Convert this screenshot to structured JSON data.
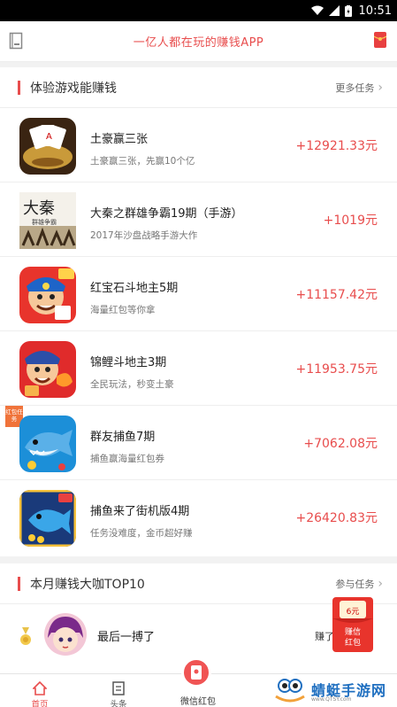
{
  "status_bar": {
    "time": "10:51"
  },
  "header": {
    "title": "一亿人都在玩的赚钱APP"
  },
  "experience_section": {
    "title": "体验游戏能赚钱",
    "more_label": "更多任务",
    "games": [
      {
        "name": "土豪赢三张",
        "desc": "土豪赢三张，先赢10个亿",
        "reward": "+12921.33元",
        "icon": "poker-cards-icon"
      },
      {
        "name": "大秦之群雄争霸19期（手游）",
        "desc": "2017年沙盘战略手游大作",
        "reward": "+1019元",
        "icon": "daqin-game-icon"
      },
      {
        "name": "红宝石斗地主5期",
        "desc": "海量红包等你拿",
        "reward": "+11157.42元",
        "icon": "landlord-game-icon"
      },
      {
        "name": "锦鲤斗地主3期",
        "desc": "全民玩法，秒变土豪",
        "reward": "+11953.75元",
        "icon": "koi-landlord-game-icon"
      },
      {
        "name": "群友捕鱼7期",
        "desc": "捕鱼赢海量红包券",
        "reward": "+7062.08元",
        "icon": "shark-fishing-game-icon",
        "badge": "红包任务"
      },
      {
        "name": "捕鱼来了街机版4期",
        "desc": "任务没难度，金币超好赚",
        "reward": "+26420.83元",
        "icon": "arcade-fishing-game-icon"
      }
    ]
  },
  "top_section": {
    "title": "本月赚钱大咖TOP10",
    "more_label": "参与任务",
    "entries": [
      {
        "name": "最后一搏了",
        "amount": "赚了"
      }
    ]
  },
  "float_badge": {
    "amount": "6元",
    "line1": "赚信",
    "line2": "红包"
  },
  "tab_bar": {
    "tabs": [
      "首页",
      "头条",
      "微信红包"
    ]
  },
  "watermark": {
    "text": "蜻蜓手游网",
    "sub": "www.QTSY.com"
  },
  "colors": {
    "accent": "#e84d4d",
    "reward": "#e84d4d"
  }
}
